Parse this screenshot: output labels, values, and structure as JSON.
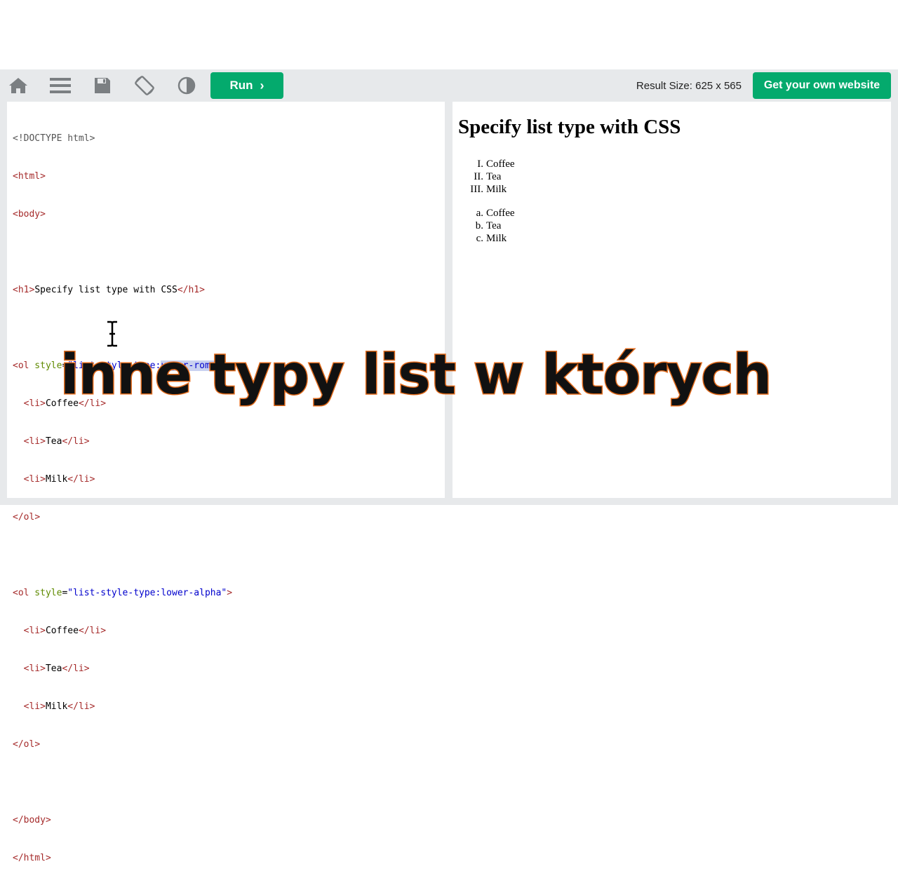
{
  "toolbar": {
    "run_label": "Run",
    "run_chevron": "›",
    "result_size": "Result Size: 625 x 565",
    "get_site_label": "Get your own website",
    "icons": [
      "home-icon",
      "menu-icon",
      "save-icon",
      "rotate-icon",
      "contrast-icon"
    ]
  },
  "editor": {
    "lines": {
      "l1": "<!DOCTYPE html>",
      "l2a": "<",
      "l2b": "html",
      "l2c": ">",
      "l3a": "<",
      "l3b": "body",
      "l3c": ">",
      "l5a": "<",
      "l5b": "h1",
      "l5c": ">",
      "l5d": "Specify list type with CSS",
      "l5e": "</",
      "l5f": "h1",
      "l5g": ">",
      "l7a": "<",
      "l7b": "ol",
      "l7c": " style",
      "l7d": "=",
      "l7e": "\"list-style-type:",
      "l7f": "upper-roman",
      "l7g": "\"",
      "l7h": ">",
      "l8a": "  <",
      "l8b": "li",
      "l8c": ">",
      "l8d": "Coffee",
      "l8e": "</",
      "l8f": "li",
      "l8g": ">",
      "l9a": "  <",
      "l9b": "li",
      "l9c": ">",
      "l9d": "Tea",
      "l9e": "</",
      "l9f": "li",
      "l9g": ">",
      "l10a": "  <",
      "l10b": "li",
      "l10c": ">",
      "l10d": "Milk",
      "l10e": "</",
      "l10f": "li",
      "l10g": ">",
      "l11a": "</",
      "l11b": "ol",
      "l11c": ">",
      "l13a": "<",
      "l13b": "ol",
      "l13c": " style",
      "l13d": "=",
      "l13e": "\"list-style-type:lower-alpha\"",
      "l13f": ">",
      "l14a": "  <",
      "l14b": "li",
      "l14c": ">",
      "l14d": "Coffee",
      "l14e": "</",
      "l14f": "li",
      "l14g": ">",
      "l15a": "  <",
      "l15b": "li",
      "l15c": ">",
      "l15d": "Tea",
      "l15e": "</",
      "l15f": "li",
      "l15g": ">",
      "l16a": "  <",
      "l16b": "li",
      "l16c": ">",
      "l16d": "Milk",
      "l16e": "</",
      "l16f": "li",
      "l16g": ">",
      "l17a": "</",
      "l17b": "ol",
      "l17c": ">",
      "l19a": "</",
      "l19b": "body",
      "l19c": ">",
      "l20a": "</",
      "l20b": "html",
      "l20c": ">"
    }
  },
  "result": {
    "heading": "Specify list type with CSS",
    "list1": [
      {
        "marker": "I.",
        "text": "Coffee"
      },
      {
        "marker": "II.",
        "text": "Tea"
      },
      {
        "marker": "III.",
        "text": "Milk"
      }
    ],
    "list2": [
      {
        "marker": "a.",
        "text": "Coffee"
      },
      {
        "marker": "b.",
        "text": "Tea"
      },
      {
        "marker": "c.",
        "text": "Milk"
      }
    ]
  },
  "caption": "inne typy list w których",
  "colors": {
    "accent_green": "#04aa6d",
    "toolbar_bg": "#e7e9eb",
    "caption_outline": "#e06a1b"
  }
}
